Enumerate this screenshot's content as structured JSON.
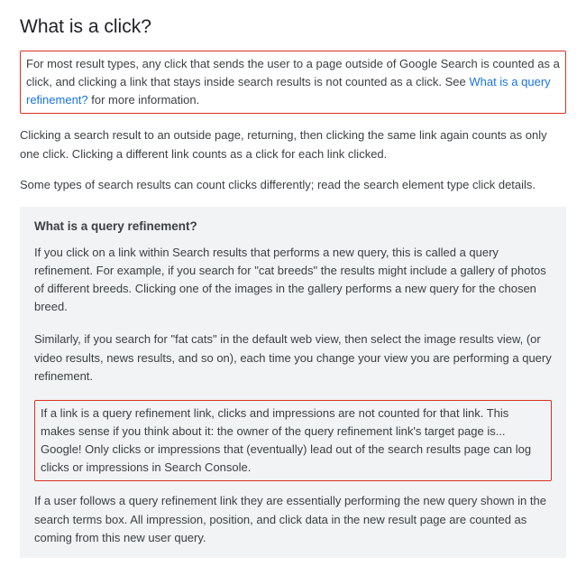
{
  "title": "What is a click?",
  "intro": {
    "p1_before_link": "For most result types, any click that sends the user to a page outside of Google Search is counted as a click, and clicking a link that stays inside search results is not counted as a click. See ",
    "link_text": "What is a query refinement?",
    "p1_after_link": " for more information."
  },
  "p2": "Clicking a search result to an outside page, returning, then clicking the same link again counts as only one click. Clicking a different link counts as a click for each link clicked.",
  "p3": "Some types of search results can count clicks differently; read the search element type click details.",
  "callout": {
    "heading": "What is a query refinement?",
    "p1": "If you click on a link within Search results that performs a new query, this is called a query refinement. For example, if you search for \"cat breeds\" the results might include a gallery of photos of different breeds. Clicking one of the images in the gallery performs a new query for the chosen breed.",
    "p2": "Similarly, if you search for \"fat cats\" in the default web view, then select the image results view, (or video results, news results, and so on), each time you change your view you are performing a query refinement.",
    "p3": "If a link is a query refinement link, clicks and impressions are not counted for that link. This makes sense if you think about it: the owner of the query refinement link's target page is... Google! Only clicks or impressions that (eventually) lead out of the search results page can log clicks or impressions in Search Console.",
    "p4": "If a user follows a query refinement link they are essentially performing the new query shown in the search terms box. All impression, position, and click data in the new result page are counted as coming from this new user query."
  }
}
